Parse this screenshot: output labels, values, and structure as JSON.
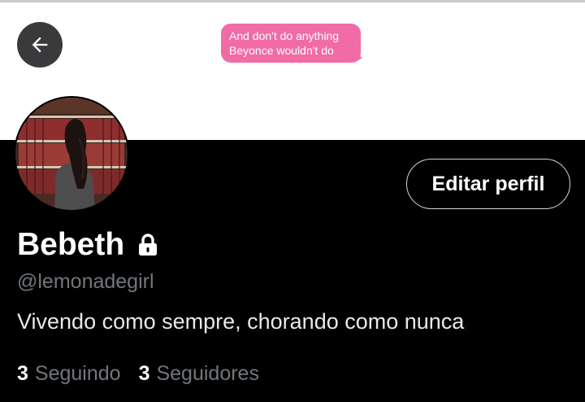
{
  "header": {
    "back_icon": "arrow-left-icon",
    "bubble_lines": [
      "And don't do anything",
      "Beyonce wouldn't do"
    ]
  },
  "profile": {
    "name": "Bebeth",
    "lock_icon": "lock-icon",
    "handle": "@lemonadegirl",
    "bio": "Vivendo como sempre, chorando como nunca",
    "edit_button": "Editar perfil"
  },
  "stats": [
    {
      "count": "3",
      "label": "Seguindo"
    },
    {
      "count": "3",
      "label": "Seguidores"
    }
  ],
  "colors": {
    "background": "#000000",
    "banner": "#ffffff",
    "bubble": "#f16ba6",
    "muted_text": "#71767b"
  }
}
